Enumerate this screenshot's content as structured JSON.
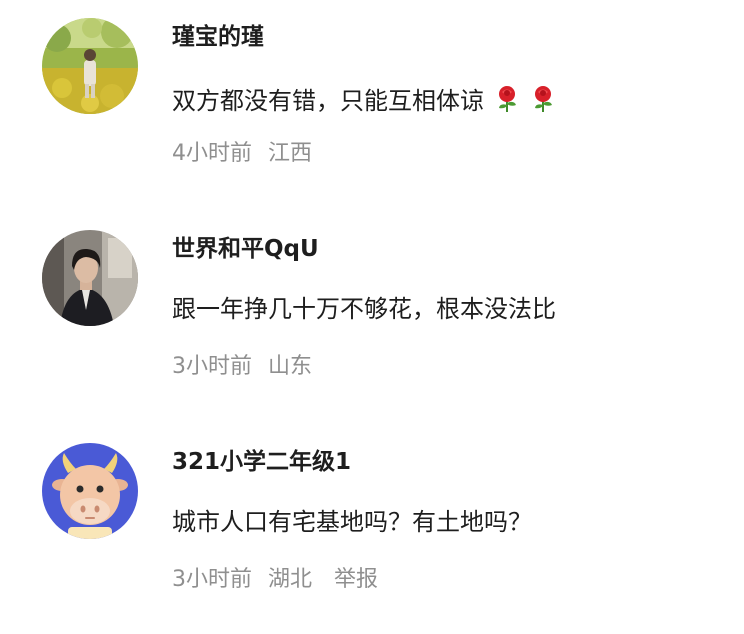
{
  "comments": [
    {
      "avatar_icon": "avatar-photo-field",
      "username": "瑾宝的瑾",
      "text": "双方都没有错，只能互相体谅",
      "emojis": [
        "rose-icon",
        "rose-icon"
      ],
      "time": "4小时前",
      "location": "江西"
    },
    {
      "avatar_icon": "avatar-photo-man",
      "username": "世界和平QqU",
      "text": "跟一年挣几十万不够花，根本没法比",
      "time": "3小时前",
      "location": "山东"
    },
    {
      "avatar_icon": "avatar-cartoon-cow",
      "username": "321小学二年级1",
      "text": "城市人口有宅基地吗？有土地吗？",
      "time": "3小时前",
      "location": "湖北",
      "report_label": "举报"
    }
  ],
  "colors": {
    "text": "#1e1e1e",
    "meta": "#8f8f8f",
    "cow_bg": "#4a5ad6",
    "cow_face": "#f3c6a6"
  }
}
